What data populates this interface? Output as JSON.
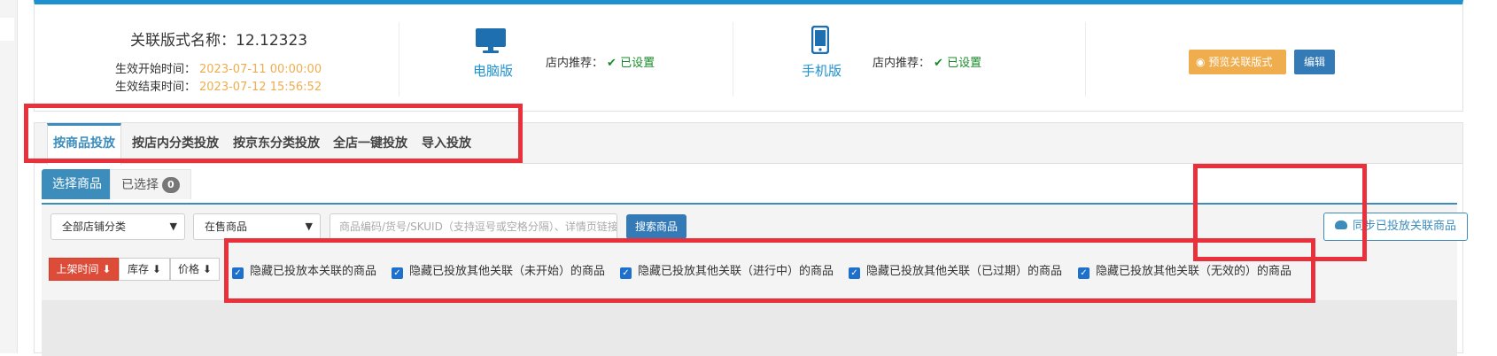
{
  "layout_name": {
    "label": "关联版式名称：",
    "value": "12.12323"
  },
  "effective": {
    "start_label": "生效开始时间：",
    "start_value": "2023-07-11 00:00:00",
    "end_label": "生效结束时间：",
    "end_value": "2023-07-12 15:56:52"
  },
  "pc": {
    "label": "电脑版",
    "rec_label": "店内推荐：",
    "rec_status": "已设置",
    "icon": "monitor-icon"
  },
  "mobile": {
    "label": "手机版",
    "rec_label": "店内推荐：",
    "rec_status": "已设置",
    "icon": "smartphone-icon"
  },
  "actions": {
    "preview": "预览关联版式",
    "edit": "编辑"
  },
  "tabs": [
    "按商品投放",
    "按店内分类投放",
    "按京东分类投放",
    "全店一键投放",
    "导入投放"
  ],
  "subtabs": {
    "select": "选择商品",
    "selected": "已选择",
    "selected_count": "0"
  },
  "filters": {
    "category": "全部店铺分类",
    "status": "在售商品",
    "search_placeholder": "商品编码/货号/SKUID（支持逗号或空格分隔）、详情页链接",
    "search_button": "搜索商品",
    "sync_button": "同步已投放关联商品"
  },
  "sort": [
    "上架时间",
    "库存",
    "价格"
  ],
  "checkboxes": [
    "隐藏已投放本关联的商品",
    "隐藏已投放其他关联（未开始）的商品",
    "隐藏已投放其他关联（进行中）的商品",
    "隐藏已投放其他关联（已过期）的商品",
    "隐藏已投放其他关联（无效的）的商品"
  ],
  "colors": {
    "accent": "#3c8dbc",
    "highlight": "#e8313a",
    "warning": "#f0ad4e",
    "ok": "#1a8a2a"
  }
}
